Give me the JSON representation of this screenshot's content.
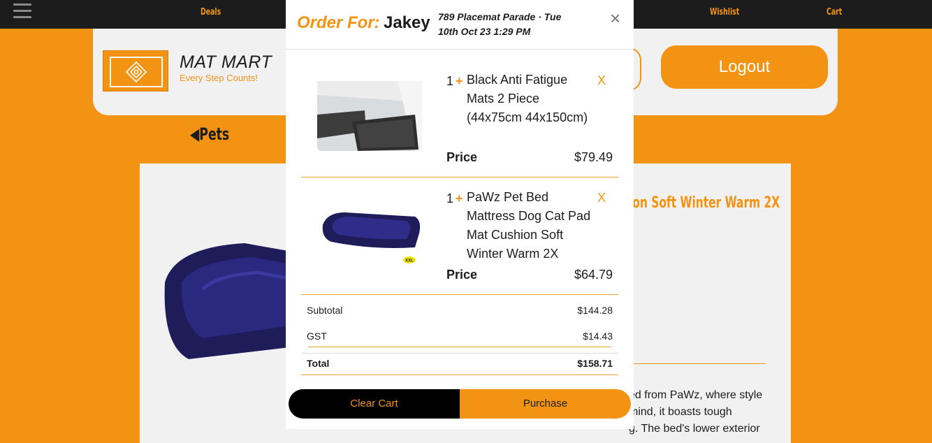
{
  "nav": {
    "deals": "Deals",
    "wishlist": "Wishlist",
    "cart": "Cart"
  },
  "header": {
    "brand": "MAT MART",
    "tagline": "Every Step Counts!",
    "logout_label": "Logout"
  },
  "page": {
    "back_label": "◀Pets",
    "product_title_fragment": "ion Soft Winter Warm 2X",
    "description_lines": [
      "ed from PaWz, where style",
      " mind, it boasts tough",
      "g. The bed's lower exterior"
    ]
  },
  "modal": {
    "order_for_label": "Order For:",
    "customer_name": "Jakey",
    "meta_line1": "789 Placemat Parade · Tue",
    "meta_line2": "10th Oct 23 1:29 PM",
    "close_glyph": "×",
    "items": [
      {
        "qty": "1",
        "plus": "+",
        "name": "Black Anti Fatigue Mats 2 Piece (44x75cm 44x150cm)",
        "remove": "X",
        "price_label": "Price",
        "price": "$79.49"
      },
      {
        "qty": "1",
        "plus": "+",
        "name": "PaWz Pet Bed Mattress Dog Cat Pad Mat Cushion Soft Winter Warm 2X",
        "remove": "X",
        "price_label": "Price",
        "price": "$64.79",
        "badge": "XXL"
      }
    ],
    "summary": {
      "subtotal_label": "Subtotal",
      "subtotal": "$144.28",
      "gst_label": "GST",
      "gst": "$14.43",
      "total_label": "Total",
      "total": "$158.71"
    },
    "clear_label": "Clear Cart",
    "purchase_label": "Purchase"
  },
  "colors": {
    "accent": "#f39313",
    "dark": "#1c1c1c"
  }
}
